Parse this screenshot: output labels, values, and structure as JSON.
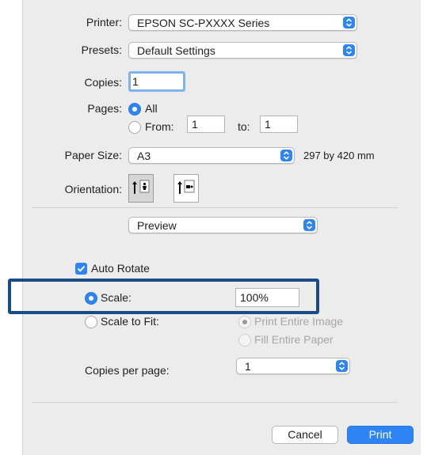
{
  "colors": {
    "accent": "#2d84f5",
    "highlight_frame": "#1b4b86"
  },
  "printer": {
    "label": "Printer:",
    "value": "EPSON SC-PXXXX Series"
  },
  "presets": {
    "label": "Presets:",
    "value": "Default Settings"
  },
  "copies": {
    "label": "Copies:",
    "value": "1"
  },
  "pages": {
    "label": "Pages:",
    "all_label": "All",
    "from_label": "From:",
    "from_value": "1",
    "to_label": "to:",
    "to_value": "1"
  },
  "paper_size": {
    "label": "Paper Size:",
    "value": "A3",
    "dimensions": "297 by 420 mm"
  },
  "orientation": {
    "label": "Orientation:",
    "options": [
      "portrait-icon",
      "landscape-icon"
    ],
    "selected": "portrait"
  },
  "section_popup": {
    "value": "Preview"
  },
  "preview": {
    "auto_rotate_label": "Auto Rotate",
    "scale_label": "Scale:",
    "scale_value": "100%",
    "scale_to_fit_label": "Scale to Fit:",
    "print_entire_image_label": "Print Entire Image",
    "fill_entire_paper_label": "Fill Entire Paper",
    "copies_per_page_label": "Copies per page:",
    "copies_per_page_value": "1"
  },
  "buttons": {
    "cancel": "Cancel",
    "print": "Print"
  }
}
